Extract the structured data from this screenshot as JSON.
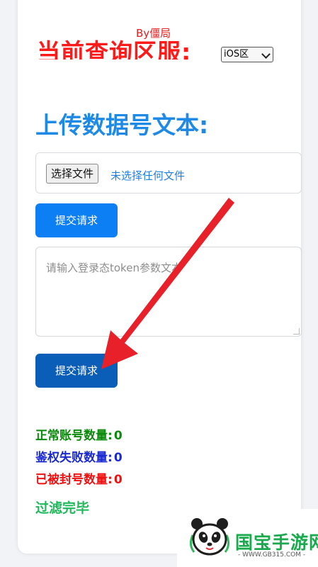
{
  "header": {
    "byline": "By僵局",
    "region_title": "当前查询区服:",
    "region_select": "iOS区"
  },
  "upload": {
    "title": "上传数据号文本:",
    "choose_file": "选择文件",
    "file_status": "未选择任何文件",
    "submit1": "提交请求",
    "textarea_placeholder": "请输入登录态token参数文本",
    "submit2": "提交请求"
  },
  "stats": {
    "normal_label": "正常账号数量:",
    "normal_value": "0",
    "auth_fail_label": "鉴权失败数量:",
    "auth_fail_value": "0",
    "banned_label": "已被封号数量:",
    "banned_value": "0",
    "done_text": "过滤完毕"
  },
  "watermark": {
    "name": "国宝手游网",
    "url": "- WWW.GB315.COM -"
  },
  "colors": {
    "region_title": "#ff1a1a",
    "upload_title": "#1f8ae6",
    "button": "#0d7ff4",
    "normal": "#0a8a0a",
    "auth_fail": "#1a2ad0",
    "banned": "#ee1111",
    "done": "#1fb85a",
    "arrow": "#e8202a"
  }
}
